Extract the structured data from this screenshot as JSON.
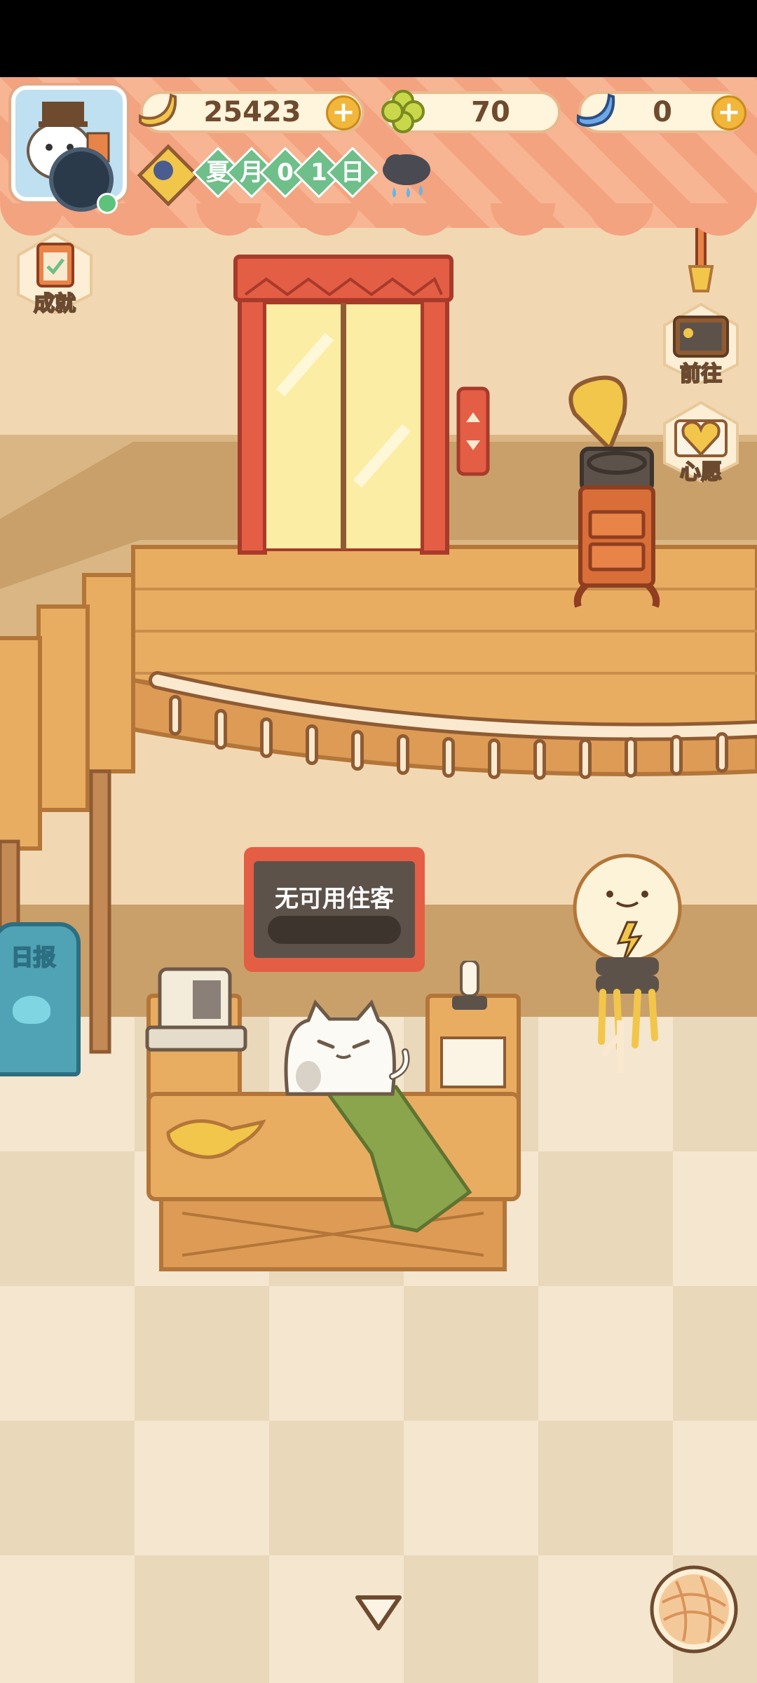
{
  "resources": {
    "bananas": {
      "icon": "banana-icon",
      "value": "25423",
      "plus": "+"
    },
    "clovers": {
      "icon": "clover-icon",
      "value": "70"
    },
    "blue_bananas": {
      "icon": "blue-banana-icon",
      "value": "0",
      "plus": "+"
    }
  },
  "calendar": {
    "chars": [
      "夏",
      "月",
      "0",
      "1",
      "日"
    ],
    "weather_icon": "rain-cloud-icon"
  },
  "side_buttons": {
    "achievements": {
      "label": "成就",
      "icon": "clipboard-icon"
    },
    "goto": {
      "label": "前往",
      "icon": "signboard-icon"
    },
    "wish": {
      "label": "心愿",
      "icon": "heart-book-icon"
    }
  },
  "reception": {
    "sign_text": "无可用住客"
  },
  "daily_news": {
    "label": "日报"
  },
  "colors": {
    "accent_orange": "#e35e45",
    "wall": "#f2d7b3",
    "wood": "#e9ad62",
    "green": "#6fbf8a"
  }
}
